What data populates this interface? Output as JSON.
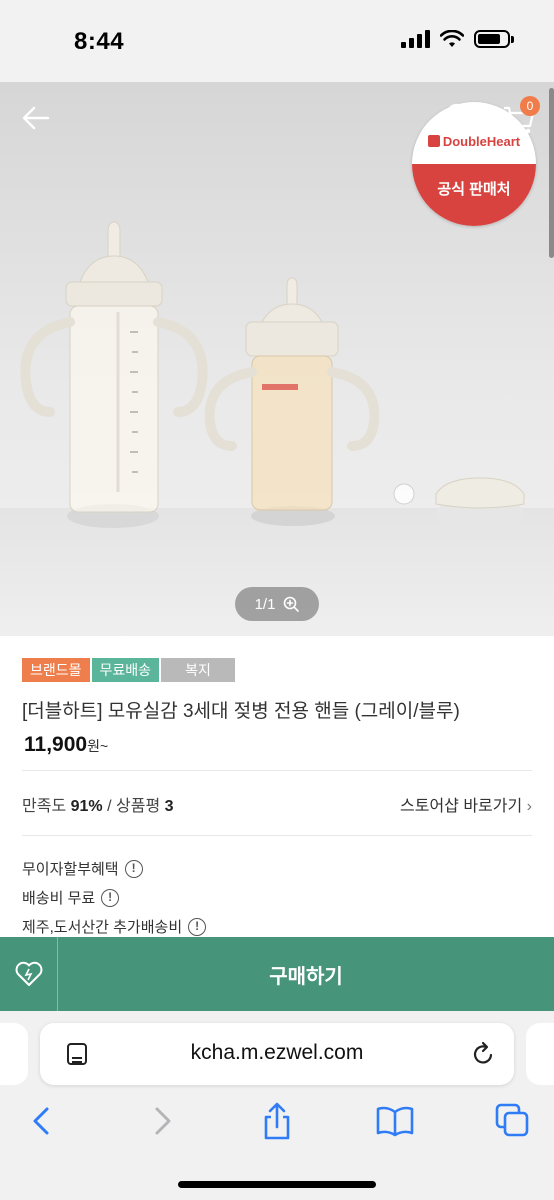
{
  "status_bar": {
    "time": "8:44"
  },
  "hero": {
    "badge_brand": "DoubleHeart",
    "badge_label": "공식 판매처",
    "cart_count": "0",
    "image_counter": "1/1"
  },
  "product": {
    "tags": [
      "브랜드몰",
      "무료배송",
      "복지"
    ],
    "title": "[더블하트] 모유실감 3세대 젖병 전용 핸들 (그레이/블루)",
    "price": "11,900",
    "price_unit": "원~",
    "satisfaction_label": "만족도",
    "satisfaction_value": "91%",
    "review_label": "/ 상품평",
    "review_count": "3",
    "store_link": "스토어샵 바로가기"
  },
  "benefits": [
    "무이자할부혜택",
    "배송비 무료",
    "제주,도서산간 추가배송비"
  ],
  "buy_bar": {
    "buy_label": "구매하기"
  },
  "browser": {
    "url": "kcha.m.ezwel.com"
  },
  "colors": {
    "accent": "#46957a",
    "brand_tag": "#ee7f4c",
    "free_tag": "#5bb59b",
    "badge_red": "#d8433f"
  }
}
